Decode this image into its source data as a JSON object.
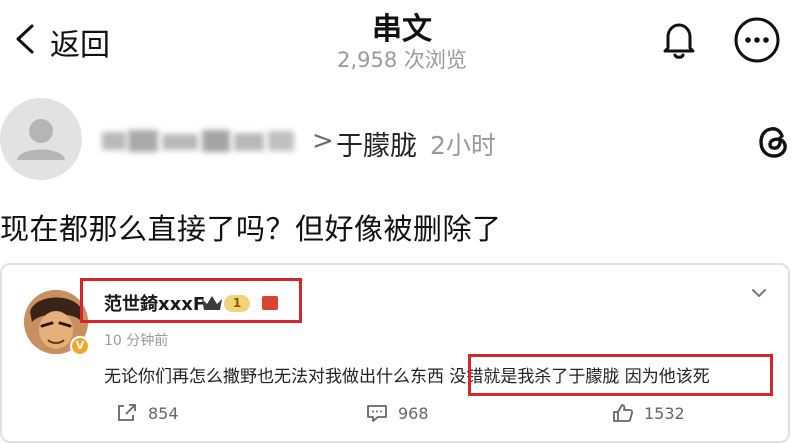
{
  "header": {
    "back_label": "返回",
    "title": "串文",
    "subtitle": "2,958 次浏览"
  },
  "post": {
    "author_arrow": ">",
    "author_name": "于朦胧",
    "time": "2小时",
    "text": "现在都那么直接了吗？但好像被删除了"
  },
  "comment": {
    "name": "范世錡xxxF",
    "level": "1",
    "time": "10 分钟前",
    "text": "无论你们再怎么撒野也无法对我做出什么东西 没错就是我杀了于朦胧 因为他该死",
    "repost_count": "854",
    "reply_count": "968",
    "like_count": "1532"
  },
  "colors": {
    "highlight": "#d9252a",
    "muted_text": "#9a9a9a",
    "badge_gold": "#f2a527"
  }
}
